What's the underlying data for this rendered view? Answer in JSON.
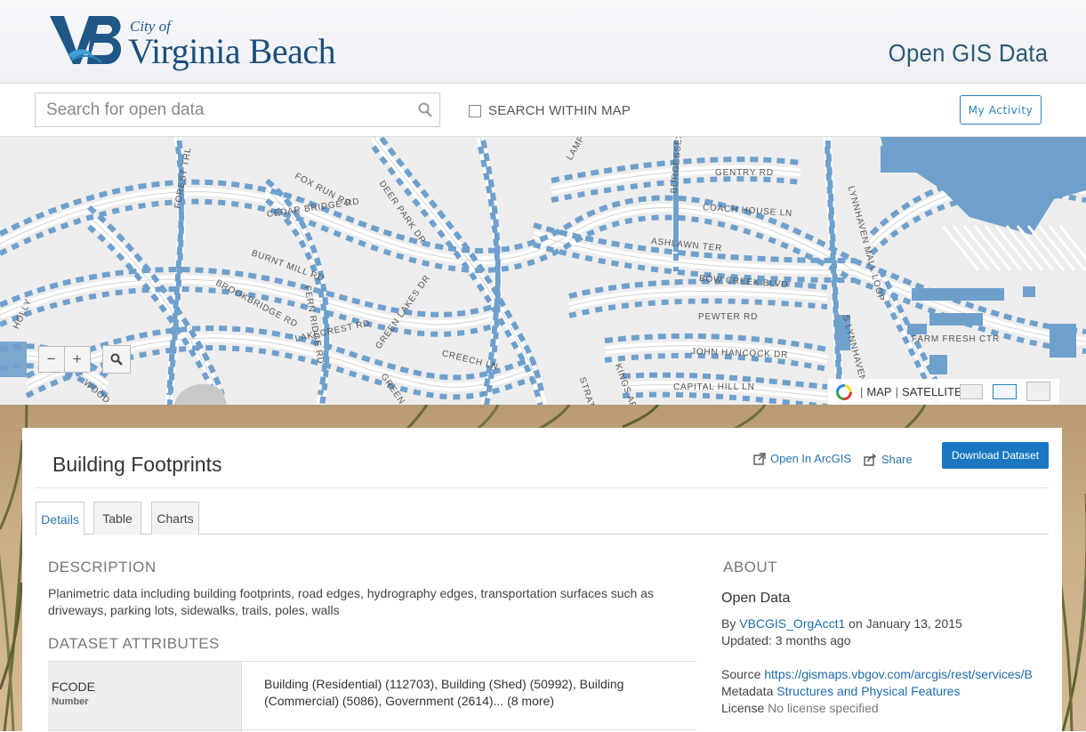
{
  "header": {
    "logo_city": "City of",
    "logo_name": "Virginia Beach",
    "site_title": "Open GIS Data"
  },
  "search": {
    "placeholder": "Search for open data",
    "within_map_label": "SEARCH WITHIN MAP",
    "my_activity_label": "My Activity"
  },
  "map": {
    "street_labels": [
      "FOX RUN RD",
      "DEER PARK DR",
      "CEDAR BRIDGE RD",
      "BURNT MILL RD",
      "BROOKBRIDGE RD",
      "FERN RIDGE RD",
      "LAKECREST RD",
      "GREEN LAKES DR",
      "GREEN LAKES CIR",
      "CREECH LN",
      "FOREST TRL",
      "LAMPLIGHT",
      "BURGESSES LN",
      "GENTRY RD",
      "COACH HOUSE LN",
      "ASHLAWN TER",
      "BOW CREEK BLVD",
      "PEWTER RD",
      "JOHN HANCOCK DR",
      "CAPITAL HILL LN",
      "STRATFORD RD",
      "KINGS ARMS DR",
      "LYNNHAVEN MALL LOOP",
      "S LYNNHAVEN RD",
      "FARM FRESH CTR",
      "HOLLY",
      "WOOD"
    ],
    "zoom_out": "−",
    "zoom_in": "+",
    "basemap_map": "MAP",
    "basemap_satellite": "SATELLITE",
    "basemap_sep": "|"
  },
  "dataset": {
    "title": "Building Footprints",
    "open_in_arcgis": "Open In ArcGIS",
    "share": "Share",
    "download": "Download Dataset",
    "tabs": [
      "Details",
      "Table",
      "Charts"
    ],
    "active_tab": "Details"
  },
  "details": {
    "description_heading": "DESCRIPTION",
    "description": "Planimetric data including building footprints, road edges, hydrography edges, transportation surfaces such as driveways, parking lots, sidewalks, trails, poles, walls",
    "attributes_heading": "DATASET ATTRIBUTES",
    "attributes": [
      {
        "name": "FCODE",
        "type": "Number",
        "values": "Building (Residential) (112703), Building (Shed) (50992), Building (Commercial) (5086), Government (2614)... (8 more)"
      }
    ]
  },
  "about": {
    "heading": "ABOUT",
    "title": "Open Data",
    "by_label": "By",
    "owner": "VBCGIS_OrgAcct1",
    "date_text": "on January 13, 2015",
    "updated_label": "Updated:",
    "updated_value": "3 months ago",
    "source_label": "Source",
    "source_url": "https://gismaps.vbgov.com/arcgis/rest/services/Bas",
    "metadata_label": "Metadata",
    "metadata_value": "Structures and Physical Features",
    "license_label": "License",
    "license_value": "No license specified"
  },
  "colors": {
    "accent": "#1a78c2",
    "link": "#2a74b0",
    "building_fill": "#6fa0cc",
    "header_text": "#2e5a74"
  }
}
